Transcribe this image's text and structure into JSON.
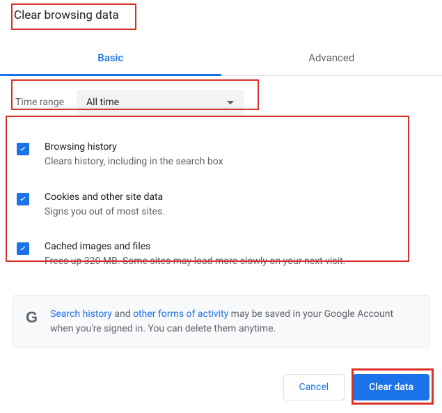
{
  "title": "Clear browsing data",
  "tabs": {
    "basic": "Basic",
    "advanced": "Advanced"
  },
  "timeRange": {
    "label": "Time range",
    "selected": "All time"
  },
  "options": [
    {
      "title": "Browsing history",
      "desc": "Clears history, including in the search box",
      "checked": true
    },
    {
      "title": "Cookies and other site data",
      "desc": "Signs you out of most sites.",
      "checked": true
    },
    {
      "title": "Cached images and files",
      "desc": "Frees up 320 MB. Some sites may load more slowly on your next visit.",
      "checked": true
    }
  ],
  "info": {
    "link1": "Search history",
    "mid1": " and ",
    "link2": "other forms of activity",
    "rest": " may be saved in your Google Account when you're signed in. You can delete them anytime."
  },
  "buttons": {
    "cancel": "Cancel",
    "clear": "Clear data"
  }
}
